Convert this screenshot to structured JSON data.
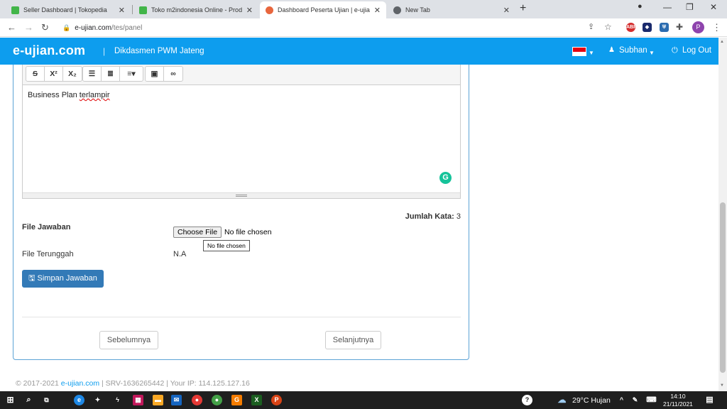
{
  "browser": {
    "tabs": [
      {
        "title": "Seller Dashboard | Tokopedia",
        "active": false
      },
      {
        "title": "Toko m2indonesia Online - Produ",
        "active": false
      },
      {
        "title": "Dashboard Peserta Ujian | e-ujian",
        "active": true
      },
      {
        "title": "New Tab",
        "active": false
      }
    ],
    "address_host": "e-ujian.com",
    "address_path": "/tes/panel",
    "profile_initial": "P",
    "extensions": [
      "ABP"
    ]
  },
  "navbar": {
    "brand": "e-ujian.com",
    "org": "Dikdasmen PWM Jateng",
    "user": "Subhan",
    "logout": "Log Out"
  },
  "editor": {
    "toolbar_buttons": [
      "S",
      "X²",
      "X₂",
      "bulleted-list",
      "numbered-list",
      "align",
      "image",
      "link"
    ],
    "text_plain": "Business Plan ",
    "text_misspelled": "terlampir"
  },
  "form": {
    "word_count_label": "Jumlah Kata:",
    "word_count_value": "3",
    "file_label": "File Jawaban",
    "choose_file": "Choose File",
    "no_file": "No file chosen",
    "tooltip": "No file chosen",
    "uploaded_label": "File Terunggah",
    "uploaded_value": "N.A",
    "save_button": "Simpan Jawaban",
    "prev_button": "Sebelumnya",
    "next_button": "Selanjutnya"
  },
  "footer": {
    "copyright": "© 2017-2021 ",
    "site": "e-ujian.com",
    "rest": " | SRV-1636265442 | Your IP: 114.125.127.16"
  },
  "taskbar": {
    "weather": "29°C  Hujan",
    "time": "14:10",
    "date": "21/11/2021"
  },
  "colors": {
    "navbar": "#0d9dee",
    "primary_button": "#337ab7",
    "panel_border": "#5ca3d6"
  }
}
